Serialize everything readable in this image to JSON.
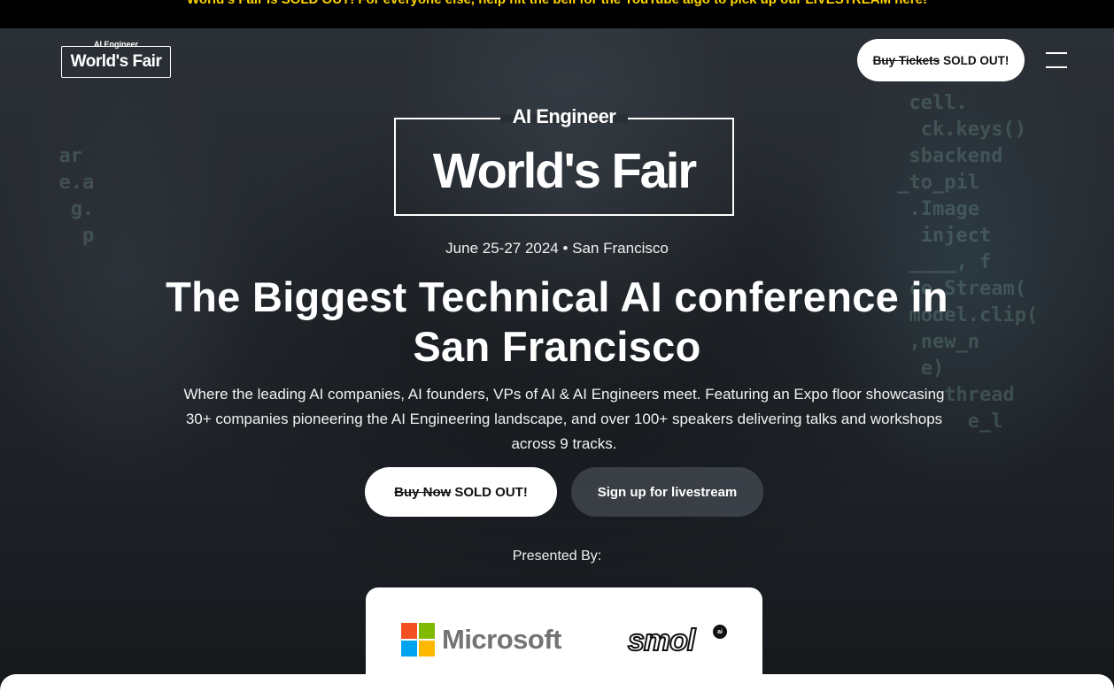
{
  "announcement": {
    "text": "World's Fair is SOLD OUT! For everyone else, help hit the bell for the YouTube algo to pick up our LIVESTREAM here!"
  },
  "header": {
    "logo": {
      "top": "AI Engineer",
      "name": "World's Fair"
    },
    "tickets_button": {
      "struck": "Buy Tickets",
      "status": "SOLD OUT!"
    },
    "menu_icon": "hamburger-menu-icon"
  },
  "hero": {
    "logo": {
      "top": "AI Engineer",
      "name": "World's Fair"
    },
    "date": "June 25-27 2024 • San Francisco",
    "headline": "The Biggest Technical AI conference in San Francisco",
    "description": "Where the leading AI companies, AI founders, VPs of AI & AI Engineers meet. Featuring an Expo floor showcasing 30+ companies pioneering the AI Engineering landscape, and over 100+ speakers delivering talks and workshops across 9 tracks.",
    "buy_button": {
      "struck": "Buy Now",
      "status": "SOLD OUT!"
    },
    "stream_button": "Sign up for livestream",
    "presented_by": "Presented By:"
  },
  "sponsors": [
    {
      "name": "Microsoft",
      "icon": "microsoft-logo",
      "colors": [
        "#f25022",
        "#7fba00",
        "#00a4ef",
        "#ffb900"
      ]
    },
    {
      "name": "smol",
      "badge": "ai",
      "icon": "smol-ai-logo"
    }
  ],
  "colors": {
    "announcement_text": "#ffd400",
    "button_bg": "#ffffff",
    "text": "#ffffff"
  }
}
